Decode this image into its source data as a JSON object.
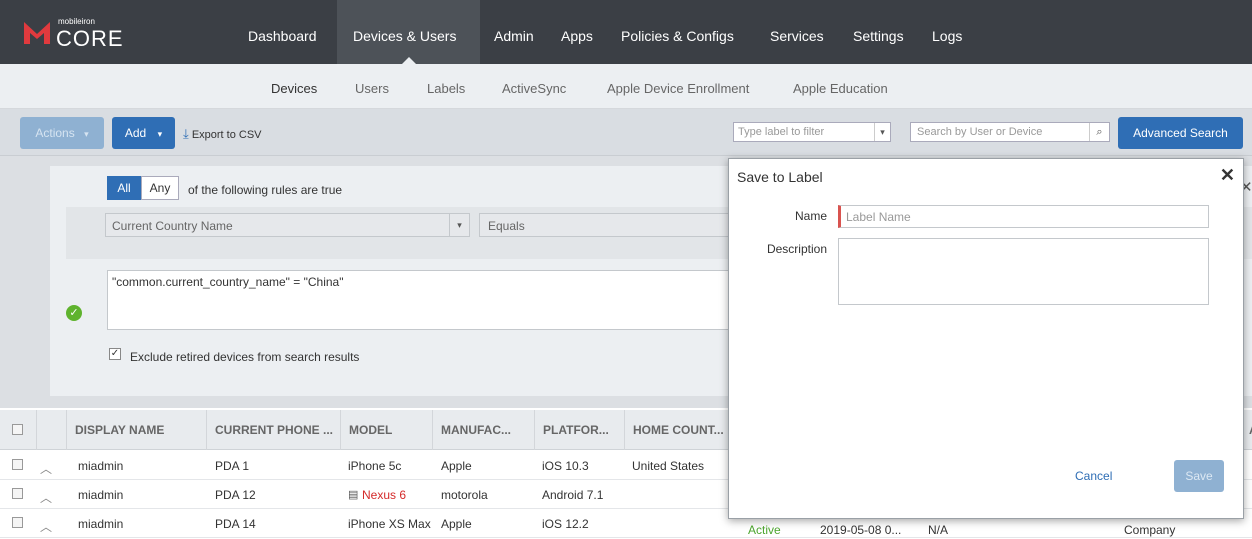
{
  "brand": {
    "small": "mobileiron",
    "big": "CORE"
  },
  "topnav": [
    "Dashboard",
    "Devices & Users",
    "Admin",
    "Apps",
    "Policies & Configs",
    "Services",
    "Settings",
    "Logs"
  ],
  "subnav": [
    "Devices",
    "Users",
    "Labels",
    "ActiveSync",
    "Apple Device Enrollment",
    "Apple Education"
  ],
  "toolbar": {
    "actions": "Actions",
    "add": "Add",
    "export": "Export to CSV",
    "label_filter_placeholder": "Type label to filter",
    "search_placeholder": "Search by User or Device",
    "advanced_search": "Advanced Search"
  },
  "search_panel": {
    "all": "All",
    "any": "Any",
    "rules_text": "of the following rules are true",
    "field": "Current Country Name",
    "operator": "Equals",
    "query": "\"common.current_country_name\" =  \"China\"",
    "exclude_label": "Exclude retired devices from search results",
    "exclude_checked": true
  },
  "table": {
    "headers": [
      "DISPLAY NAME",
      "CURRENT PHONE ...",
      "MODEL",
      "MANUFAC...",
      "PLATFOR...",
      "HOME COUNT..."
    ],
    "rows": [
      {
        "display_name": "miadmin",
        "phone": "PDA 1",
        "model": "iPhone 5c",
        "manufacturer": "Apple",
        "platform": "iOS 10.3",
        "home_country": "United States",
        "status": "",
        "date": "",
        "extra": "",
        "ownership": ""
      },
      {
        "display_name": "miadmin",
        "phone": "PDA 12",
        "model": "Nexus 6",
        "manufacturer": "motorola",
        "platform": "Android 7.1",
        "home_country": "",
        "status": "",
        "date": "",
        "extra": "",
        "ownership": ""
      },
      {
        "display_name": "miadmin",
        "phone": "PDA 14",
        "model": "iPhone XS Max",
        "manufacturer": "Apple",
        "platform": "iOS 12.2",
        "home_country": "",
        "status": "Active",
        "date": "2019-05-08 0...",
        "extra": "N/A",
        "ownership": "Company"
      }
    ]
  },
  "modal": {
    "title": "Save to Label",
    "name_label": "Name",
    "name_placeholder": "Label Name",
    "description_label": "Description",
    "cancel": "Cancel",
    "save": "Save"
  },
  "colors": {
    "nav_bg": "#3b3f45",
    "primary": "#2f6eb5",
    "brand_red": "#e03a3e",
    "success": "#5fb32e"
  }
}
